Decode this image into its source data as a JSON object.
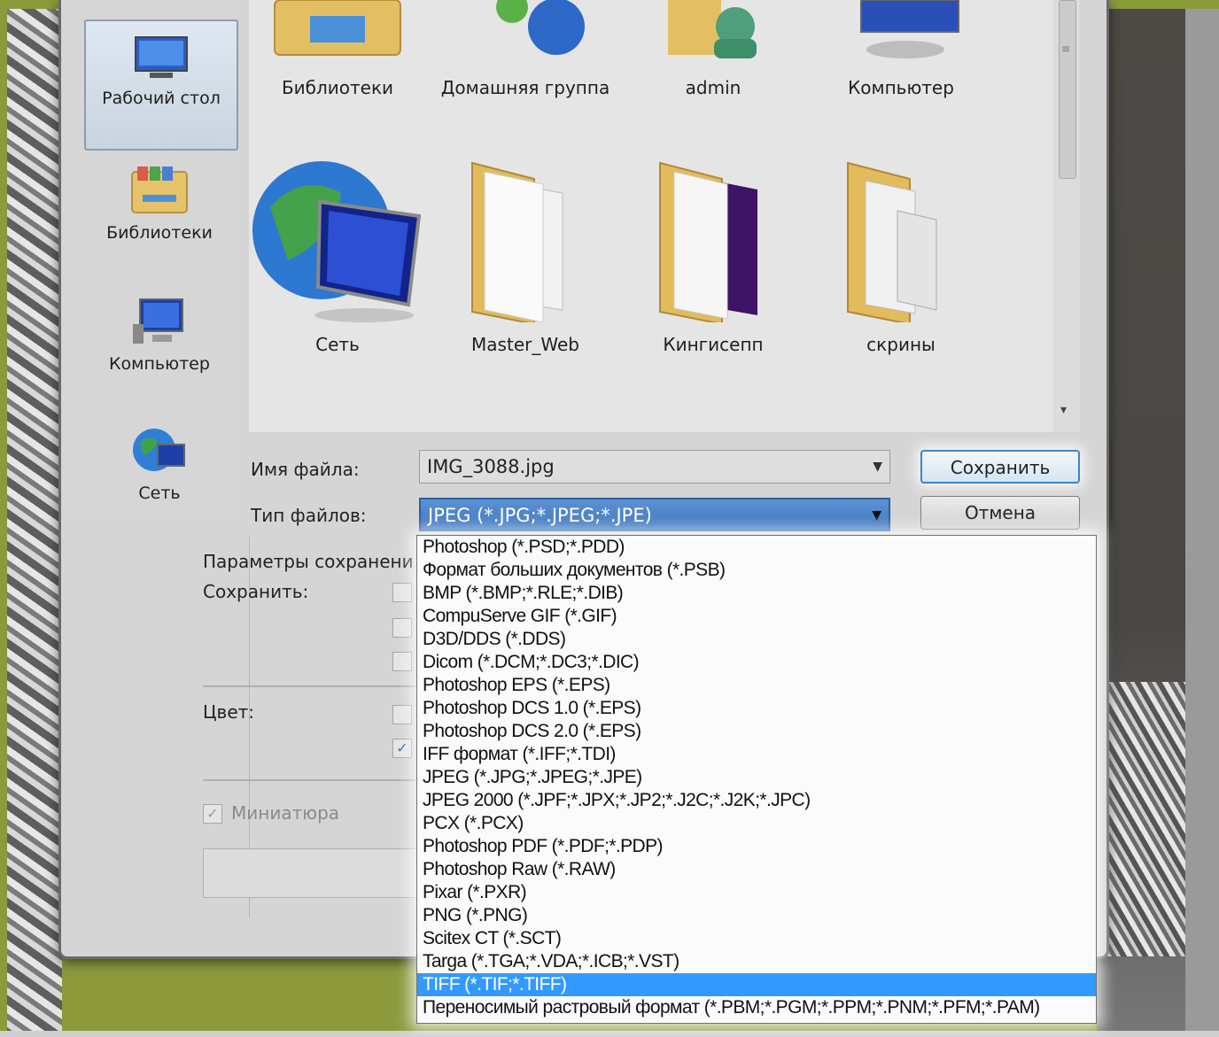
{
  "nav": {
    "items": [
      {
        "label": "Рабочий стол"
      },
      {
        "label": "Библиотеки"
      },
      {
        "label": "Компьютер"
      },
      {
        "label": "Сеть"
      }
    ]
  },
  "files": {
    "row1": [
      "Библиотеки",
      "Домашняя группа",
      "admin",
      "Компьютер"
    ],
    "row2": [
      "Сеть",
      "Master_Web",
      "Кингисепп",
      "скрины"
    ]
  },
  "form": {
    "filename_label": "Имя файла:",
    "filename_value": "IMG_3088.jpg",
    "filetype_label": "Тип файлов:",
    "filetype_value": "JPEG (*.JPG;*.JPEG;*.JPE)",
    "save_label": "Сохранить",
    "cancel_label": "Отмена"
  },
  "params": {
    "title": "Параметры сохранени",
    "save_label": "Сохранить:",
    "color_label": "Цвет:",
    "thumbnail_label": "Миниатюра"
  },
  "dropdown": {
    "options": [
      "Photoshop (*.PSD;*.PDD)",
      "Формат больших документов (*.PSB)",
      "BMP (*.BMP;*.RLE;*.DIB)",
      "CompuServe GIF (*.GIF)",
      "D3D/DDS (*.DDS)",
      "Dicom (*.DCM;*.DC3;*.DIC)",
      "Photoshop EPS (*.EPS)",
      "Photoshop DCS 1.0 (*.EPS)",
      "Photoshop DCS 2.0 (*.EPS)",
      "IFF формат (*.IFF;*.TDI)",
      "JPEG (*.JPG;*.JPEG;*.JPE)",
      "JPEG 2000 (*.JPF;*.JPX;*.JP2;*.J2C;*.J2K;*.JPC)",
      "PCX (*.PCX)",
      "Photoshop PDF (*.PDF;*.PDP)",
      "Photoshop Raw (*.RAW)",
      "Pixar (*.PXR)",
      "PNG (*.PNG)",
      "Scitex CT (*.SCT)",
      "Targa (*.TGA;*.VDA;*.ICB;*.VST)",
      "TIFF (*.TIF;*.TIFF)",
      "Переносимый растровый формат (*.PBM;*.PGM;*.PPM;*.PNM;*.PFM;*.PAM)"
    ],
    "highlighted": "TIFF (*.TIF;*.TIFF)"
  },
  "colors": {
    "highlight": "#3399ff",
    "frame": "#8c9a3c"
  }
}
